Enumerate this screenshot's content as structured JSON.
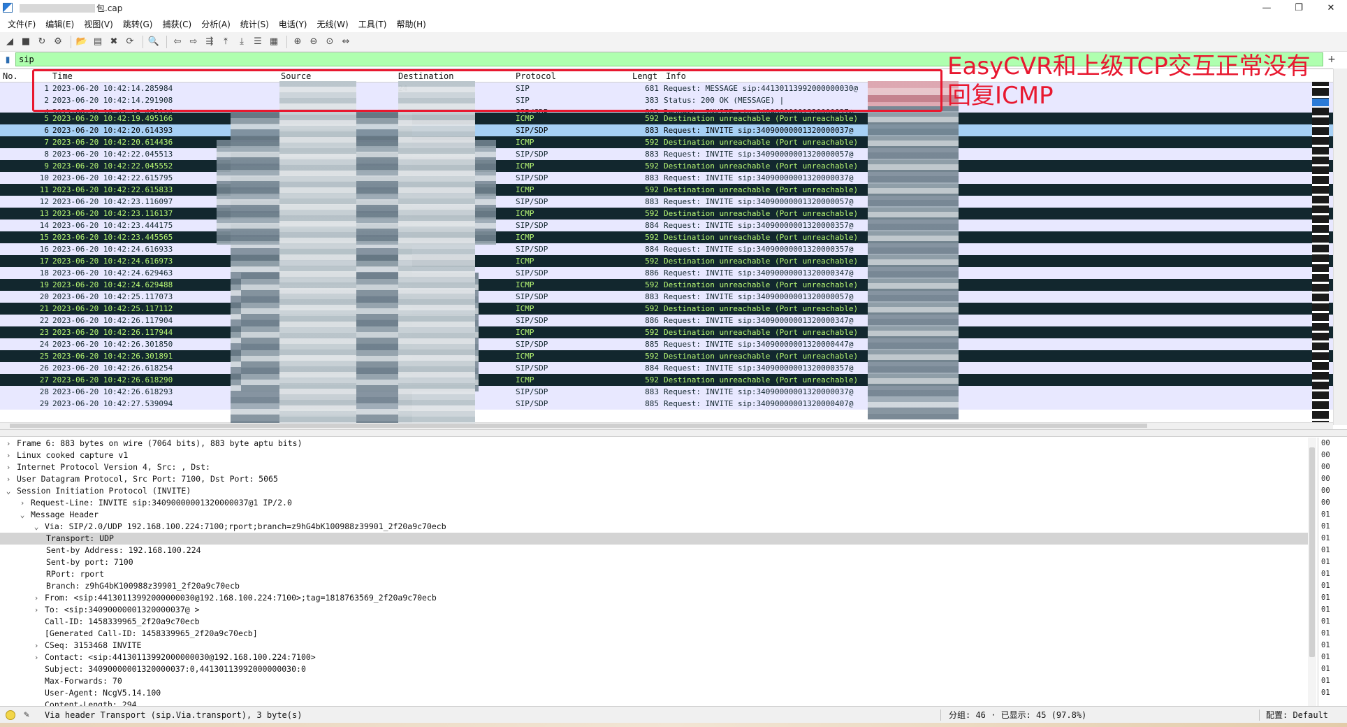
{
  "window": {
    "title_suffix": "包.cap",
    "controls": [
      "—",
      "❐",
      "✕"
    ]
  },
  "menu": [
    "文件(F)",
    "编辑(E)",
    "视图(V)",
    "跳转(G)",
    "捕获(C)",
    "分析(A)",
    "统计(S)",
    "电话(Y)",
    "无线(W)",
    "工具(T)",
    "帮助(H)"
  ],
  "toolbar_icons": [
    {
      "name": "start-capture-icon",
      "glyph": "◢"
    },
    {
      "name": "stop-capture-icon",
      "glyph": "■"
    },
    {
      "name": "restart-capture-icon",
      "glyph": "↻"
    },
    {
      "name": "capture-options-icon",
      "glyph": "⚙"
    },
    {
      "name": "open-file-icon",
      "glyph": "📂"
    },
    {
      "name": "save-file-icon",
      "glyph": "▤"
    },
    {
      "name": "close-file-icon",
      "glyph": "✖"
    },
    {
      "name": "reload-file-icon",
      "glyph": "⟳"
    },
    {
      "name": "find-packet-icon",
      "glyph": "🔍"
    },
    {
      "name": "go-back-icon",
      "glyph": "⇦"
    },
    {
      "name": "go-forward-icon",
      "glyph": "⇨"
    },
    {
      "name": "go-to-packet-icon",
      "glyph": "⇶"
    },
    {
      "name": "first-packet-icon",
      "glyph": "⤒"
    },
    {
      "name": "last-packet-icon",
      "glyph": "⤓"
    },
    {
      "name": "auto-scroll-icon",
      "glyph": "☰"
    },
    {
      "name": "colorize-icon",
      "glyph": "▦"
    },
    {
      "name": "zoom-in-icon",
      "glyph": "⊕"
    },
    {
      "name": "zoom-out-icon",
      "glyph": "⊖"
    },
    {
      "name": "zoom-normal-icon",
      "glyph": "⊙"
    },
    {
      "name": "resize-columns-icon",
      "glyph": "⇔"
    }
  ],
  "filter": {
    "value": "sip",
    "add_label": "+"
  },
  "packet_list": {
    "headers": {
      "no": "No.",
      "time": "Time",
      "source": "Source",
      "destination": "Destination",
      "protocol": "Protocol",
      "length": "Lengt",
      "info": "Info"
    },
    "rows": [
      {
        "no": "1",
        "time": "2023-06-20 10:42:14.285984",
        "src": "",
        "dst": "24",
        "proto": "SIP",
        "len": "681",
        "info": "Request: MESSAGE sip:44130113992000000030@",
        "kind": "sip"
      },
      {
        "no": "2",
        "time": "2023-06-20 10:42:14.291908",
        "src": "",
        "dst": "",
        "proto": "SIP",
        "len": "383",
        "info": "Status: 200 OK (MESSAGE) |",
        "kind": "sip"
      },
      {
        "no": "4",
        "time": "2023-06-20 10:42:19.495114",
        "src": "",
        "dst": "",
        "proto": "SIP/SDP",
        "len": "883",
        "info": "Request: INVITE sip:34090000001320000037@",
        "kind": "cut"
      },
      {
        "no": "5",
        "time": "2023-06-20 10:42:19.495166",
        "src": "",
        "dst": "24",
        "proto": "ICMP",
        "len": "592",
        "info": "Destination unreachable (Port unreachable)",
        "kind": "icmp"
      },
      {
        "no": "6",
        "time": "2023-06-20 10:42:20.614393",
        "src": "",
        "dst": "",
        "proto": "SIP/SDP",
        "len": "883",
        "info": "Request: INVITE sip:34090000001320000037@",
        "kind": "sel"
      },
      {
        "no": "7",
        "time": "2023-06-20 10:42:20.614436",
        "src": "",
        "dst": "",
        "proto": "ICMP",
        "len": "592",
        "info": "Destination unreachable (Port unreachable)",
        "kind": "icmp"
      },
      {
        "no": "8",
        "time": "2023-06-20 10:42:22.045513",
        "src": "",
        "dst": "",
        "proto": "SIP/SDP",
        "len": "883",
        "info": "Request: INVITE sip:34090000001320000057@",
        "kind": "sdp"
      },
      {
        "no": "9",
        "time": "2023-06-20 10:42:22.045552",
        "src": "",
        "dst": "",
        "proto": "ICMP",
        "len": "592",
        "info": "Destination unreachable (Port unreachable)",
        "kind": "icmp"
      },
      {
        "no": "10",
        "time": "2023-06-20 10:42:22.615795",
        "src": "",
        "dst": "",
        "proto": "SIP/SDP",
        "len": "883",
        "info": "Request: INVITE sip:34090000001320000037@",
        "kind": "sdp"
      },
      {
        "no": "11",
        "time": "2023-06-20 10:42:22.615833",
        "src": "1",
        "dst": "",
        "proto": "ICMP",
        "len": "592",
        "info": "Destination unreachable (Port unreachable)",
        "kind": "icmp"
      },
      {
        "no": "12",
        "time": "2023-06-20 10:42:23.116097",
        "src": "",
        "dst": "",
        "proto": "SIP/SDP",
        "len": "883",
        "info": "Request: INVITE sip:34090000001320000057@",
        "kind": "sdp"
      },
      {
        "no": "13",
        "time": "2023-06-20 10:42:23.116137",
        "src": "",
        "dst": "",
        "proto": "ICMP",
        "len": "592",
        "info": "Destination unreachable (Port unreachable)",
        "kind": "icmp"
      },
      {
        "no": "14",
        "time": "2023-06-20 10:42:23.444175",
        "src": "",
        "dst": "",
        "proto": "SIP/SDP",
        "len": "884",
        "info": "Request: INVITE sip:34090000001320000357@",
        "kind": "sdp"
      },
      {
        "no": "15",
        "time": "2023-06-20 10:42:23.445565",
        "src": "",
        "dst": "",
        "proto": "ICMP",
        "len": "592",
        "info": "Destination unreachable (Port unreachable)",
        "kind": "icmp"
      },
      {
        "no": "16",
        "time": "2023-06-20 10:42:24.616933",
        "src": "",
        "dst": "",
        "proto": "SIP/SDP",
        "len": "884",
        "info": "Request: INVITE sip:34090000001320000357@",
        "kind": "sdp"
      },
      {
        "no": "17",
        "time": "2023-06-20 10:42:24.616973",
        "src": "",
        "dst": "",
        "proto": "ICMP",
        "len": "592",
        "info": "Destination unreachable (Port unreachable)",
        "kind": "icmp"
      },
      {
        "no": "18",
        "time": "2023-06-20 10:42:24.629463",
        "src": "",
        "dst": "",
        "proto": "SIP/SDP",
        "len": "886",
        "info": "Request: INVITE sip:34090000001320000347@",
        "kind": "sdp"
      },
      {
        "no": "19",
        "time": "2023-06-20 10:42:24.629488",
        "src": "",
        "dst": "",
        "proto": "ICMP",
        "len": "592",
        "info": "Destination unreachable (Port unreachable)",
        "kind": "icmp"
      },
      {
        "no": "20",
        "time": "2023-06-20 10:42:25.117073",
        "src": "",
        "dst": "",
        "proto": "SIP/SDP",
        "len": "883",
        "info": "Request: INVITE sip:34090000001320000057@",
        "kind": "sdp"
      },
      {
        "no": "21",
        "time": "2023-06-20 10:42:25.117112",
        "src": "",
        "dst": "",
        "proto": "ICMP",
        "len": "592",
        "info": "Destination unreachable (Port unreachable)",
        "kind": "icmp"
      },
      {
        "no": "22",
        "time": "2023-06-20 10:42:26.117904",
        "src": "",
        "dst": "",
        "proto": "SIP/SDP",
        "len": "886",
        "info": "Request: INVITE sip:34090000001320000347@",
        "kind": "sdp"
      },
      {
        "no": "23",
        "time": "2023-06-20 10:42:26.117944",
        "src": "",
        "dst": "",
        "proto": "ICMP",
        "len": "592",
        "info": "Destination unreachable (Port unreachable)",
        "kind": "icmp"
      },
      {
        "no": "24",
        "time": "2023-06-20 10:42:26.301850",
        "src": "",
        "dst": "",
        "proto": "SIP/SDP",
        "len": "885",
        "info": "Request: INVITE sip:34090000001320000447@",
        "kind": "sdp"
      },
      {
        "no": "25",
        "time": "2023-06-20 10:42:26.301891",
        "src": "",
        "dst": "1",
        "proto": "ICMP",
        "len": "592",
        "info": "Destination unreachable (Port unreachable)",
        "kind": "icmp"
      },
      {
        "no": "26",
        "time": "2023-06-20 10:42:26.618254",
        "src": "",
        "dst": "",
        "proto": "SIP/SDP",
        "len": "884",
        "info": "Request: INVITE sip:34090000001320000357@",
        "kind": "sdp"
      },
      {
        "no": "27",
        "time": "2023-06-20 10:42:26.618290",
        "src": "",
        "dst": "",
        "proto": "ICMP",
        "len": "592",
        "info": "Destination unreachable (Port unreachable)",
        "kind": "icmp"
      },
      {
        "no": "28",
        "time": "2023-06-20 10:42:26.618293",
        "src": "",
        "dst": "",
        "proto": "SIP/SDP",
        "len": "883",
        "info": "Request: INVITE sip:34090000001320000037@",
        "kind": "sdp"
      },
      {
        "no": "29",
        "time": "2023-06-20 10:42:27.539094",
        "src": "",
        "dst": "",
        "proto": "SIP/SDP",
        "len": "885",
        "info": "Request: INVITE sip:34090000001320000407@",
        "kind": "sdp"
      }
    ]
  },
  "annotation": {
    "text": "EasyCVR和上级TCP交互正常没有回复ICMP",
    "color": "#e8182f"
  },
  "details": [
    {
      "indent": 0,
      "arrow": "›",
      "text": "Frame 6: 883 bytes on wire (7064 bits), 883 byte   aptu         bits)"
    },
    {
      "indent": 0,
      "arrow": "›",
      "text": "Linux cooked capture v1"
    },
    {
      "indent": 0,
      "arrow": "›",
      "text": "Internet Protocol Version 4, Src:                 , Dst:"
    },
    {
      "indent": 0,
      "arrow": "›",
      "text": "User Datagram Protocol, Src Port: 7100, Dst Port: 5065"
    },
    {
      "indent": 0,
      "arrow": "⌄",
      "text": "Session Initiation Protocol (INVITE)"
    },
    {
      "indent": 1,
      "arrow": "›",
      "text": "Request-Line: INVITE sip:34090000001320000037@1                   IP/2.0"
    },
    {
      "indent": 1,
      "arrow": "⌄",
      "text": "Message Header"
    },
    {
      "indent": 2,
      "arrow": "⌄",
      "text": "Via: SIP/2.0/UDP 192.168.100.224:7100;rport;branch=z9hG4bK100988z39901_2f20a9c70ecb"
    },
    {
      "indent": 3,
      "arrow": "",
      "text": "Transport: UDP",
      "highlight": true
    },
    {
      "indent": 3,
      "arrow": "",
      "text": "Sent-by Address: 192.168.100.224"
    },
    {
      "indent": 3,
      "arrow": "",
      "text": "Sent-by port: 7100"
    },
    {
      "indent": 3,
      "arrow": "",
      "text": "RPort: rport"
    },
    {
      "indent": 3,
      "arrow": "",
      "text": "Branch: z9hG4bK100988z39901_2f20a9c70ecb"
    },
    {
      "indent": 2,
      "arrow": "›",
      "text": "From: <sip:44130113992000000030@192.168.100.224:7100>;tag=1818763569_2f20a9c70ecb"
    },
    {
      "indent": 2,
      "arrow": "›",
      "text": "To: <sip:34090000001320000037@                  >"
    },
    {
      "indent": 2,
      "arrow": "",
      "text": "Call-ID: 1458339965_2f20a9c70ecb"
    },
    {
      "indent": 2,
      "arrow": "",
      "text": "[Generated Call-ID: 1458339965_2f20a9c70ecb]"
    },
    {
      "indent": 2,
      "arrow": "›",
      "text": "CSeq: 3153468 INVITE"
    },
    {
      "indent": 2,
      "arrow": "›",
      "text": "Contact: <sip:44130113992000000030@192.168.100.224:7100>"
    },
    {
      "indent": 2,
      "arrow": "",
      "text": "Subject: 34090000001320000037:0,44130113992000000030:0"
    },
    {
      "indent": 2,
      "arrow": "",
      "text": "Max-Forwards: 70"
    },
    {
      "indent": 2,
      "arrow": "",
      "text": "User-Agent: NcgV5.14.100"
    },
    {
      "indent": 2,
      "arrow": "",
      "text": "Content-Length: 294"
    }
  ],
  "hex_column": [
    "00",
    "00",
    "00",
    "00",
    "00",
    "00",
    "01",
    "01",
    "01",
    "01",
    "01",
    "01",
    "01",
    "01",
    "01",
    "01",
    "01",
    "01",
    "01",
    "01",
    "01",
    "01"
  ],
  "status": {
    "message": "Via header Transport (sip.Via.transport), 3 byte(s)",
    "counts": "分组: 46 · 已显示: 45 (97.8%)",
    "profile": "配置: Default"
  }
}
